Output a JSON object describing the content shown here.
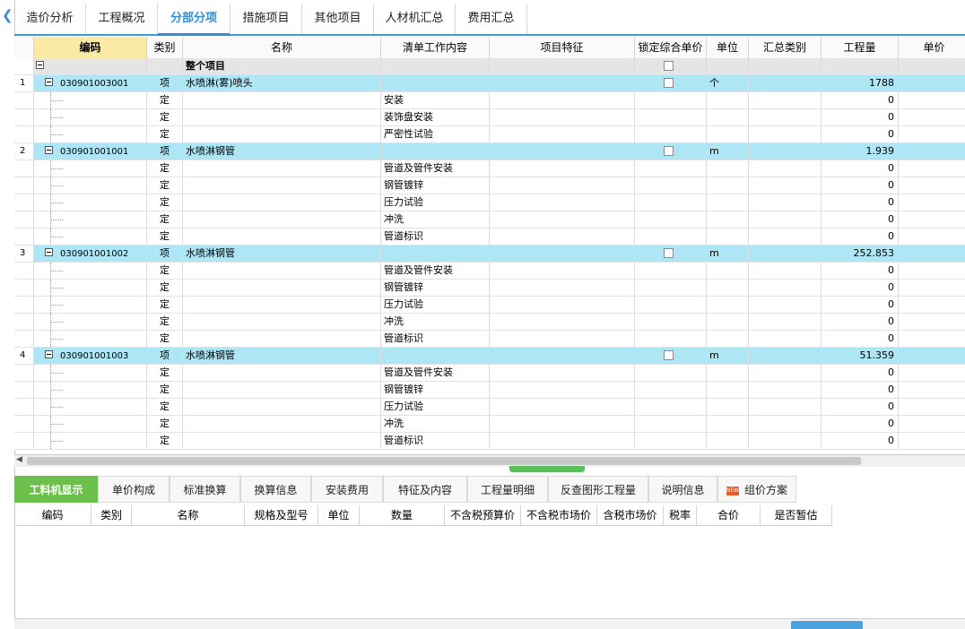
{
  "top_tabs": [
    {
      "label": "造价分析",
      "active": false
    },
    {
      "label": "工程概况",
      "active": false
    },
    {
      "label": "分部分项",
      "active": true
    },
    {
      "label": "措施项目",
      "active": false
    },
    {
      "label": "其他项目",
      "active": false
    },
    {
      "label": "人材机汇总",
      "active": false
    },
    {
      "label": "费用汇总",
      "active": false
    }
  ],
  "grid": {
    "columns": [
      "编码",
      "类别",
      "名称",
      "清单工作内容",
      "项目特征",
      "锁定综合单价",
      "单位",
      "汇总类别",
      "工程量",
      "单价"
    ],
    "rows": [
      {
        "kind": "top",
        "num": "",
        "code": "",
        "type": "",
        "name": "整个项目",
        "content": "",
        "unit": "",
        "qty": ""
      },
      {
        "kind": "item",
        "num": "1",
        "code": "030901003001",
        "type": "项",
        "name": "水喷淋(雾)喷头",
        "content": "",
        "unit": "个",
        "qty": "1788"
      },
      {
        "kind": "sub",
        "num": "",
        "code": "",
        "type": "定",
        "name": "",
        "content": "安装",
        "unit": "",
        "qty": "0"
      },
      {
        "kind": "sub",
        "num": "",
        "code": "",
        "type": "定",
        "name": "",
        "content": "装饰盘安装",
        "unit": "",
        "qty": "0"
      },
      {
        "kind": "sub",
        "num": "",
        "code": "",
        "type": "定",
        "name": "",
        "content": "严密性试验",
        "unit": "",
        "qty": "0"
      },
      {
        "kind": "item",
        "num": "2",
        "code": "030901001001",
        "type": "项",
        "name": "水喷淋钢管",
        "content": "",
        "unit": "m",
        "qty": "1.939"
      },
      {
        "kind": "sub",
        "num": "",
        "code": "",
        "type": "定",
        "name": "",
        "content": "管道及管件安装",
        "unit": "",
        "qty": "0"
      },
      {
        "kind": "sub",
        "num": "",
        "code": "",
        "type": "定",
        "name": "",
        "content": "钢管镀锌",
        "unit": "",
        "qty": "0"
      },
      {
        "kind": "sub",
        "num": "",
        "code": "",
        "type": "定",
        "name": "",
        "content": "压力试验",
        "unit": "",
        "qty": "0"
      },
      {
        "kind": "sub",
        "num": "",
        "code": "",
        "type": "定",
        "name": "",
        "content": "冲洗",
        "unit": "",
        "qty": "0"
      },
      {
        "kind": "sub",
        "num": "",
        "code": "",
        "type": "定",
        "name": "",
        "content": "管道标识",
        "unit": "",
        "qty": "0"
      },
      {
        "kind": "item",
        "num": "3",
        "code": "030901001002",
        "type": "项",
        "name": "水喷淋钢管",
        "content": "",
        "unit": "m",
        "qty": "252.853"
      },
      {
        "kind": "sub",
        "num": "",
        "code": "",
        "type": "定",
        "name": "",
        "content": "管道及管件安装",
        "unit": "",
        "qty": "0"
      },
      {
        "kind": "sub",
        "num": "",
        "code": "",
        "type": "定",
        "name": "",
        "content": "钢管镀锌",
        "unit": "",
        "qty": "0"
      },
      {
        "kind": "sub",
        "num": "",
        "code": "",
        "type": "定",
        "name": "",
        "content": "压力试验",
        "unit": "",
        "qty": "0"
      },
      {
        "kind": "sub",
        "num": "",
        "code": "",
        "type": "定",
        "name": "",
        "content": "冲洗",
        "unit": "",
        "qty": "0"
      },
      {
        "kind": "sub",
        "num": "",
        "code": "",
        "type": "定",
        "name": "",
        "content": "管道标识",
        "unit": "",
        "qty": "0"
      },
      {
        "kind": "item",
        "num": "4",
        "code": "030901001003",
        "type": "项",
        "name": "水喷淋钢管",
        "content": "",
        "unit": "m",
        "qty": "51.359"
      },
      {
        "kind": "sub",
        "num": "",
        "code": "",
        "type": "定",
        "name": "",
        "content": "管道及管件安装",
        "unit": "",
        "qty": "0"
      },
      {
        "kind": "sub",
        "num": "",
        "code": "",
        "type": "定",
        "name": "",
        "content": "钢管镀锌",
        "unit": "",
        "qty": "0"
      },
      {
        "kind": "sub",
        "num": "",
        "code": "",
        "type": "定",
        "name": "",
        "content": "压力试验",
        "unit": "",
        "qty": "0"
      },
      {
        "kind": "sub",
        "num": "",
        "code": "",
        "type": "定",
        "name": "",
        "content": "冲洗",
        "unit": "",
        "qty": "0"
      },
      {
        "kind": "sub",
        "num": "",
        "code": "",
        "type": "定",
        "name": "",
        "content": "管道标识",
        "unit": "",
        "qty": "0"
      }
    ]
  },
  "bottom_tabs": [
    {
      "label": "工料机显示",
      "active": true,
      "badge": false
    },
    {
      "label": "单价构成",
      "active": false,
      "badge": false
    },
    {
      "label": "标准换算",
      "active": false,
      "badge": false
    },
    {
      "label": "换算信息",
      "active": false,
      "badge": false
    },
    {
      "label": "安装费用",
      "active": false,
      "badge": false
    },
    {
      "label": "特征及内容",
      "active": false,
      "badge": false
    },
    {
      "label": "工程量明细",
      "active": false,
      "badge": false
    },
    {
      "label": "反查图形工程量",
      "active": false,
      "badge": false
    },
    {
      "label": "说明信息",
      "active": false,
      "badge": false
    },
    {
      "label": "组价方案",
      "active": false,
      "badge": true
    }
  ],
  "badge_text": "NEW",
  "bottom_grid": {
    "columns": [
      "编码",
      "类别",
      "名称",
      "规格及型号",
      "单位",
      "数量",
      "不含税预算价",
      "不含税市场价",
      "含税市场价",
      "税率",
      "合价",
      "是否暂估"
    ]
  },
  "icons": {
    "back": "back-arrow-icon",
    "expand": "collapse-minus-icon",
    "scroll_left": "scroll-left-icon"
  },
  "colors": {
    "accent": "#2f8fd8",
    "item_row": "#aee6f6",
    "active_bottom_tab": "#6cbf4a",
    "selected_header": "#fbe9a6"
  }
}
